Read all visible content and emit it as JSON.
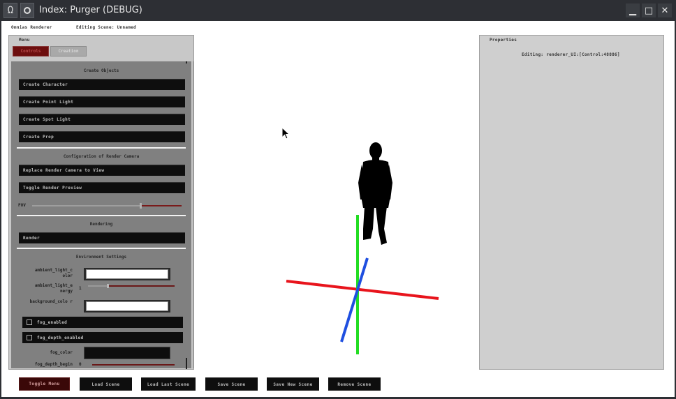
{
  "window": {
    "title": "Index: Purger (DEBUG)",
    "controls": {
      "minimize": "▁",
      "maximize": "□",
      "close": "✕"
    },
    "menu_glyph": "Ω"
  },
  "header": {
    "renderer_label": "Omnias Renderer",
    "editing_scene": "Editing Scene: Unnamed"
  },
  "menu": {
    "title": "Menu",
    "tabs": [
      {
        "label": "Controls",
        "active": true
      },
      {
        "label": "Creation",
        "active": false
      }
    ],
    "sections": {
      "create_objects": {
        "title": "Create Objects",
        "buttons": [
          "Create Character",
          "Create Point Light",
          "Create Spot Light",
          "Create Prop"
        ]
      },
      "render_camera": {
        "title": "Configuration of Render Camera",
        "buttons": [
          "Replace Render Camera to View",
          "Toggle Render Preview"
        ],
        "fov_label": "FOV",
        "fov_level": 0.72
      },
      "rendering": {
        "title": "Rendering",
        "button": "Render"
      },
      "environment": {
        "title": "Environment Settings",
        "ambient_light_color_label": "ambient_light_c olor",
        "ambient_light_energy_label": "ambient_light_e nergy",
        "ambient_light_energy_value": "1",
        "ambient_light_energy_level": 0.22,
        "background_color_label": "background_colo r",
        "fog_enabled_label": "fog_enabled",
        "fog_depth_enabled_label": "fog_depth_enabled",
        "fog_color_label": "fog_color",
        "fog_depth_begin_label": "fog_depth_begin",
        "fog_depth_begin_value": "0"
      }
    }
  },
  "properties": {
    "title": "Properties",
    "editing": "Editing: renderer_UI:[Control:48886]"
  },
  "toolbar": {
    "buttons": [
      "Toggle Menu",
      "Load Scene",
      "Load Last Scene",
      "Save Scene",
      "Save New Scene",
      "Remove Scene"
    ]
  },
  "colors": {
    "axis_x": "#e8141c",
    "axis_y": "#22dd22",
    "axis_z": "#1f4fe0",
    "accent_tab": "#6d0e0e"
  }
}
